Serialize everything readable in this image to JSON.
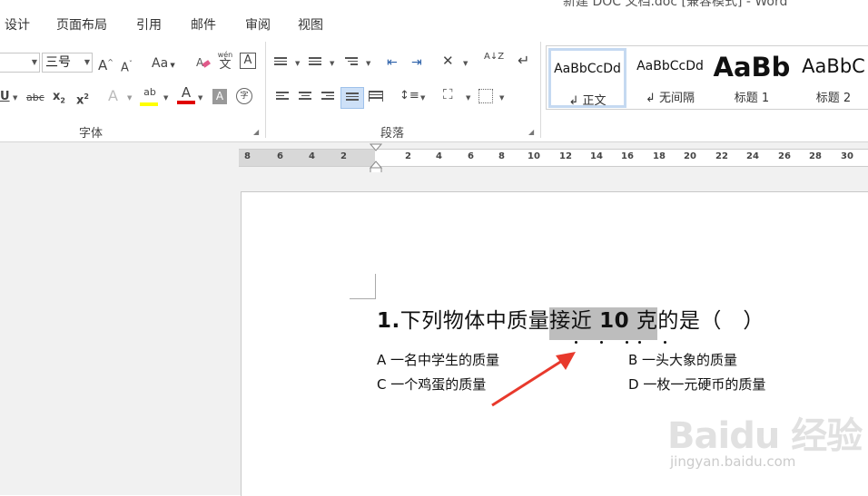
{
  "window": {
    "title": "新建 DOC 文档.doc [兼容模式] - Word"
  },
  "menu": [
    "设计",
    "页面布局",
    "引用",
    "邮件",
    "审阅",
    "视图"
  ],
  "font_group": {
    "font_size": "三号",
    "label": "字体",
    "icons": [
      "grow-font",
      "shrink-font",
      "change-case",
      "clear-formatting",
      "phonetic-guide",
      "character-border",
      "underline",
      "strikethrough",
      "subscript",
      "superscript",
      "text-effects",
      "highlight-color",
      "font-color",
      "character-shading",
      "enclose-characters"
    ],
    "grow_glyph": "A",
    "shrink_glyph": "A",
    "change_case_glyph": "Aa",
    "phonetic_top": "wén",
    "phonetic_bottom": "文",
    "border_glyph": "A",
    "underline_glyph": "U",
    "strike_glyph": "abc",
    "sub_glyph": "x",
    "sub_small": "2",
    "sup_glyph": "x",
    "sup_small": "2",
    "effects_glyph": "A",
    "highlight_glyph": "ab",
    "fontcolor_glyph": "A",
    "shading_glyph": "A",
    "enclose_glyph": "字",
    "highlight_color": "#ffff00",
    "font_color": "#e00000"
  },
  "paragraph_group": {
    "label": "段落",
    "icons": [
      "bullets",
      "numbering",
      "multilevel-list",
      "decrease-indent",
      "increase-indent",
      "chinese-layout",
      "sort",
      "show-hide-marks",
      "align-left",
      "center",
      "align-right",
      "justify",
      "distributed",
      "line-spacing",
      "shading",
      "borders"
    ],
    "sort_glyph": "A↓Z"
  },
  "styles": [
    {
      "sample": "AaBbCcDd",
      "name": "正文",
      "selected": true
    },
    {
      "sample": "AaBbCcDd",
      "name": "无间隔",
      "selected": false
    },
    {
      "sample": "AaBb",
      "name": "标题 1",
      "selected": false
    },
    {
      "sample": "AaBbC",
      "name": "标题 2",
      "selected": false
    }
  ],
  "ruler": {
    "left_numbers": [
      "8",
      "6",
      "4",
      "2"
    ],
    "right_numbers": [
      "2",
      "4",
      "6",
      "8",
      "10",
      "12",
      "14",
      "16",
      "18",
      "20",
      "22",
      "24",
      "26",
      "28",
      "30"
    ]
  },
  "document": {
    "question_prefix": "1.",
    "question_part1": "下列物体中质量",
    "question_hl1": "接近 ",
    "question_hl_num": "10",
    "question_hl2": " 克",
    "question_part2": "的是（　）",
    "options": [
      "A 一名中学生的质量",
      "B 一头大象的质量",
      "C 一个鸡蛋的质量",
      "D 一枚一元硬币的质量"
    ]
  },
  "watermark": {
    "text": "Baidu 经验",
    "url": "jingyan.baidu.com"
  },
  "colors": {
    "selection_highlight": "#bdbdbd",
    "annotation_arrow": "#e8392c",
    "style_selected_border": "#c5d9f1"
  }
}
